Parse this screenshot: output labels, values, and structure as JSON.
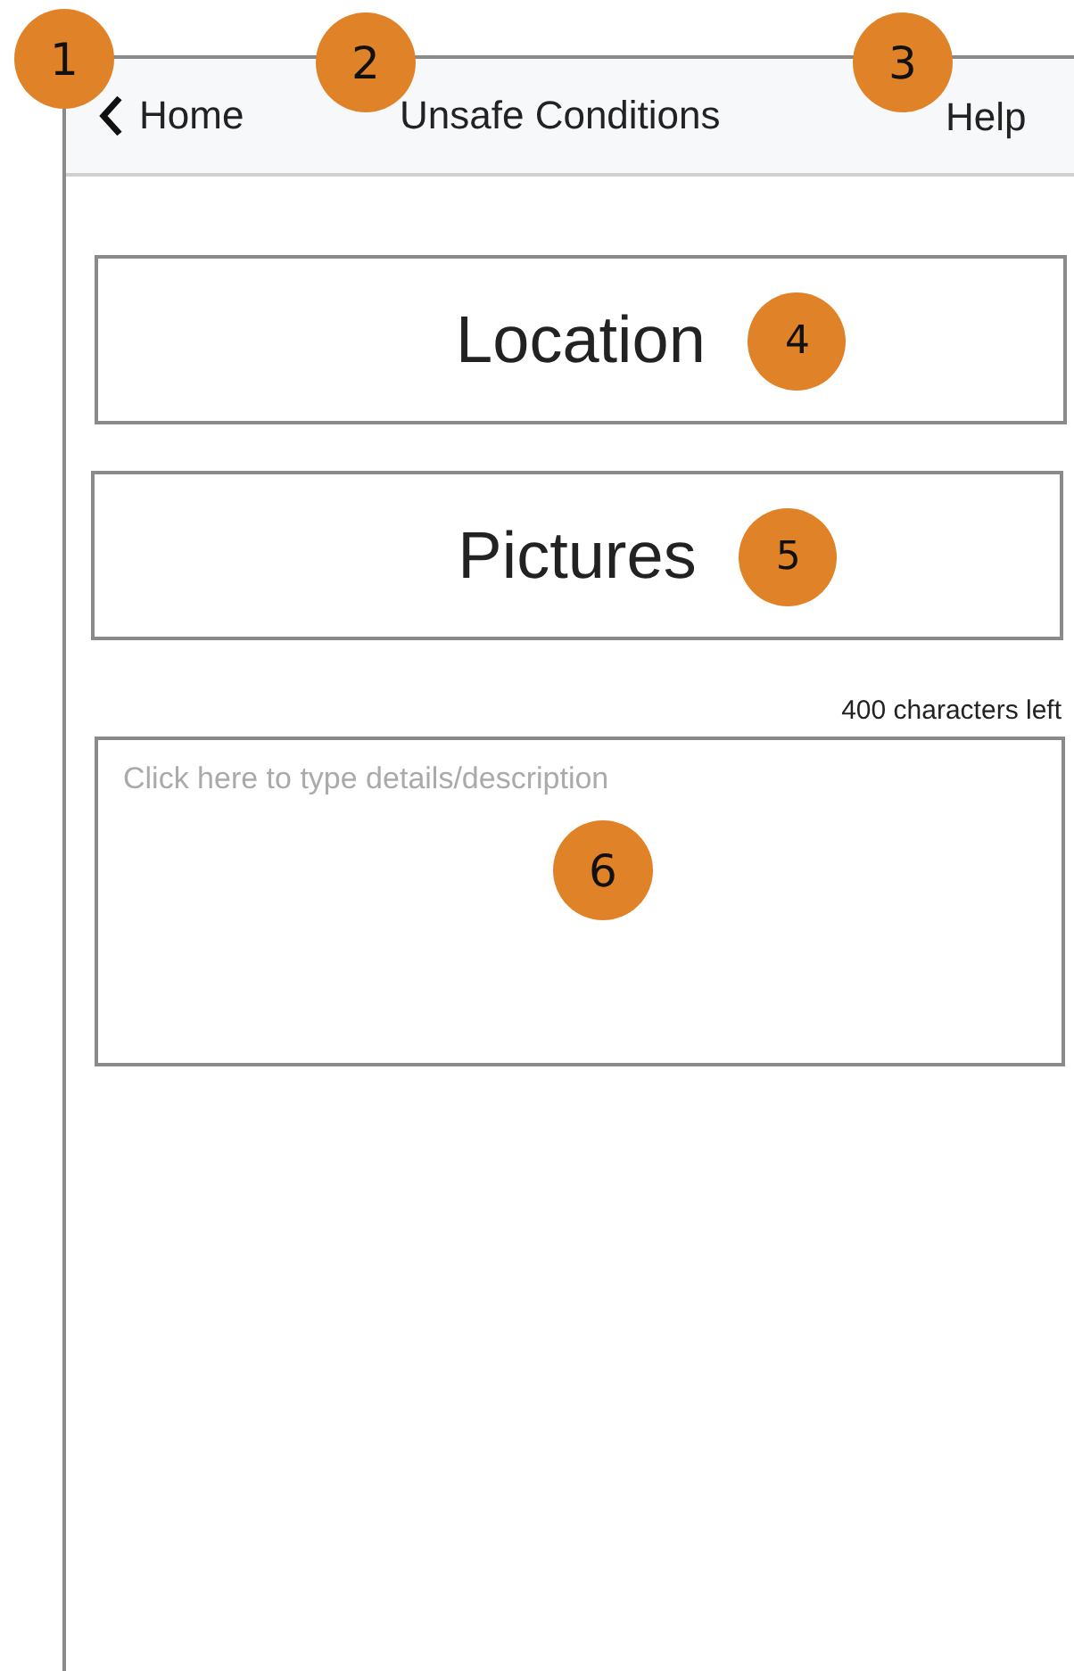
{
  "header": {
    "back": {
      "label": "Home",
      "badge": "1"
    },
    "title": {
      "text": "Unsafe Conditions",
      "badge": "2"
    },
    "help": {
      "label": "Help",
      "badge": "3"
    }
  },
  "buttons": [
    {
      "label": "Location",
      "badge": "4"
    },
    {
      "label": "Pictures",
      "badge": "5"
    }
  ],
  "description": {
    "counter": "400 characters left",
    "placeholder": "Click here to type details/description",
    "badge": "6"
  }
}
